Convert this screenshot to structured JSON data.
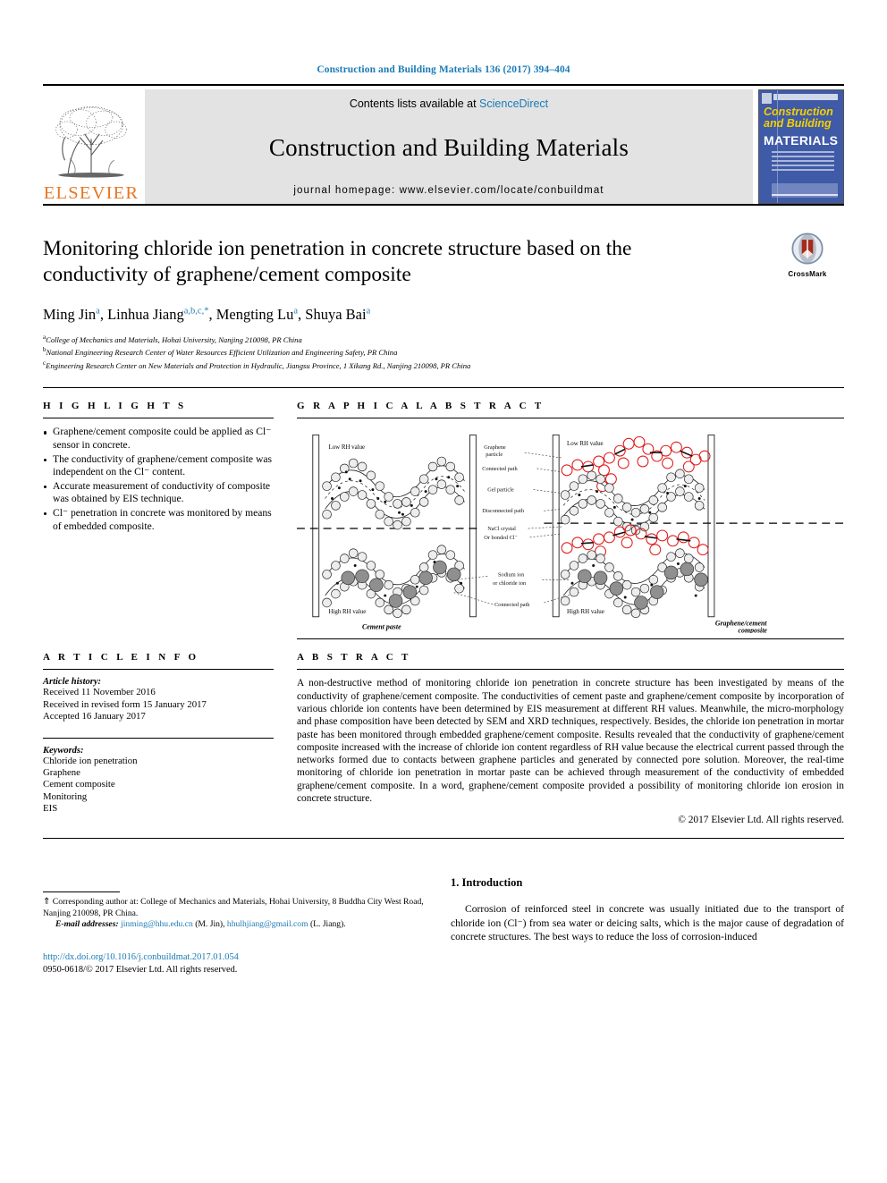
{
  "running_head": "Construction and Building Materials 136 (2017) 394–404",
  "masthead": {
    "publisher_name": "ELSEVIER",
    "contents_prefix": "Contents lists available at ",
    "contents_link": "ScienceDirect",
    "journal_name": "Construction and Building Materials",
    "homepage": "journal homepage: www.elsevier.com/locate/conbuildmat",
    "cover": {
      "line1": "Construction",
      "line2": "and Building",
      "line3": "MATERIALS"
    }
  },
  "article": {
    "title": "Monitoring chloride ion penetration in concrete structure based on the conductivity of graphene/cement composite",
    "crossmark_label": "CrossMark",
    "authors": [
      {
        "name": "Ming Jin",
        "sup": "a"
      },
      {
        "name": "Linhua Jiang",
        "sup": "a,b,c,*"
      },
      {
        "name": "Mengting Lu",
        "sup": "a"
      },
      {
        "name": "Shuya Bai",
        "sup": "a"
      }
    ],
    "affiliations": [
      {
        "marker": "a",
        "text": "College of Mechanics and Materials, Hohai University, Nanjing 210098, PR China"
      },
      {
        "marker": "b",
        "text": "National Engineering Research Center of Water Resources Efficient Utilization and Engineering Safety, PR China"
      },
      {
        "marker": "c",
        "text": "Engineering Research Center on New Materials and Protection in Hydraulic, Jiangsu Province, 1 Xikang Rd., Nanjing 210098, PR China"
      }
    ]
  },
  "highlights": {
    "heading": "H I G H L I G H T S",
    "items": [
      "Graphene/cement composite could be applied as Cl⁻ sensor in concrete.",
      "The conductivity of graphene/cement composite was independent on the Cl⁻ content.",
      "Accurate measurement of conductivity of composite was obtained by EIS technique.",
      "Cl⁻ penetration in concrete was monitored by means of embedded composite."
    ]
  },
  "graphical_abstract": {
    "heading": "G R A P H I C A L   A B S T R A C T",
    "labels": {
      "low_rh_left": "Low RH value",
      "high_rh_left": "High RH value",
      "low_rh_right": "Low RH value",
      "high_rh_right": "High RH value",
      "caption_left": "Cement paste",
      "caption_right_line1": "Graphene/cement",
      "caption_right_line2": "composite",
      "legend": [
        "Graphene particle",
        "Connected path",
        "Gel particle",
        "Disconnected path",
        "NaCl crystal",
        "Or bonded Cl⁻",
        "Sodium ion or chloride ion",
        "Connected path"
      ]
    }
  },
  "article_info": {
    "heading": "A R T I C L E   I N F O",
    "history_label": "Article history:",
    "history": [
      "Received 11 November 2016",
      "Received in revised form 15 January 2017",
      "Accepted 16 January 2017"
    ],
    "keywords_label": "Keywords:",
    "keywords": [
      "Chloride ion penetration",
      "Graphene",
      "Cement composite",
      "Monitoring",
      "EIS"
    ]
  },
  "abstract": {
    "heading": "A B S T R A C T",
    "text": "A non-destructive method of monitoring chloride ion penetration in concrete structure has been investigated by means of the conductivity of graphene/cement composite. The conductivities of cement paste and graphene/cement composite by incorporation of various chloride ion contents have been determined by EIS measurement at different RH values. Meanwhile, the micro-morphology and phase composition have been detected by SEM and XRD techniques, respectively. Besides, the chloride ion penetration in mortar paste has been monitored through embedded graphene/cement composite. Results revealed that the conductivity of graphene/cement composite increased with the increase of chloride ion content regardless of RH value because the electrical current passed through the networks formed due to contacts between graphene particles and generated by connected pore solution. Moreover, the real-time monitoring of chloride ion penetration in mortar paste can be achieved through measurement of the conductivity of embedded graphene/cement composite. In a word, graphene/cement composite provided a possibility of monitoring chloride ion erosion in concrete structure.",
    "copyright": "© 2017 Elsevier Ltd. All rights reserved."
  },
  "introduction": {
    "heading": "1. Introduction",
    "paragraph": "Corrosion of reinforced steel in concrete was usually initiated due to the transport of chloride ion (Cl⁻) from sea water or deicing salts, which is the major cause of degradation of concrete structures. The best ways to reduce the loss of corrosion-induced"
  },
  "footer": {
    "corresponding_star": "⇑",
    "corresponding": " Corresponding author at: College of Mechanics and Materials, Hohai University, 8 Buddha City West Road, Nanjing 210098, PR China.",
    "emails_label": "E-mail addresses:",
    "email1": "jinming@hhu.edu.cn",
    "email1_person": " (M. Jin), ",
    "email2": "hhulhjiang@gmail.com",
    "email2_person": " (L. Jiang).",
    "doi": "http://dx.doi.org/10.1016/j.conbuildmat.2017.01.054",
    "issn": "0950-0618/© 2017 Elsevier Ltd. All rights reserved."
  },
  "colors": {
    "link_blue": "#1a7bb5",
    "elsevier_orange": "#E87722",
    "cover_blue": "#3f5aa6",
    "cover_yellow": "#f5d000",
    "graphene_red": "#e01b1b"
  }
}
